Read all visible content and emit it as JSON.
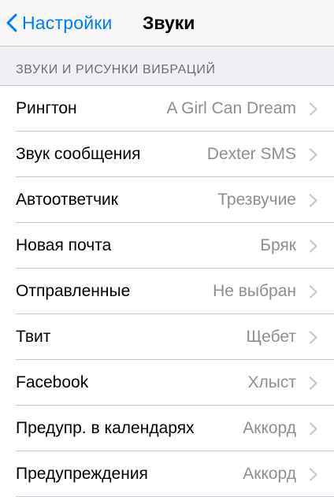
{
  "navbar": {
    "back_label": "Настройки",
    "title": "Звуки"
  },
  "section": {
    "header": "ЗВУКИ И РИСУНКИ ВИБРАЦИЙ"
  },
  "rows": [
    {
      "label": "Рингтон",
      "value": "A Girl Can Dream"
    },
    {
      "label": "Звук сообщения",
      "value": "Dexter SMS"
    },
    {
      "label": "Автоответчик",
      "value": "Трезвучие"
    },
    {
      "label": "Новая почта",
      "value": "Бряк"
    },
    {
      "label": "Отправленные",
      "value": "Не выбран"
    },
    {
      "label": "Твит",
      "value": "Щебет"
    },
    {
      "label": "Facebook",
      "value": "Хлыст"
    },
    {
      "label": "Предупр. в календарях",
      "value": "Аккорд"
    },
    {
      "label": "Предупреждения",
      "value": "Аккорд"
    }
  ],
  "colors": {
    "accent": "#007aff",
    "background": "#efeff4",
    "secondary_text": "#8e8e93",
    "separator": "#c8c7cc",
    "chevron": "#c7c7cc"
  },
  "icons": {
    "back": "chevron-left-icon",
    "disclosure": "chevron-right-icon"
  }
}
